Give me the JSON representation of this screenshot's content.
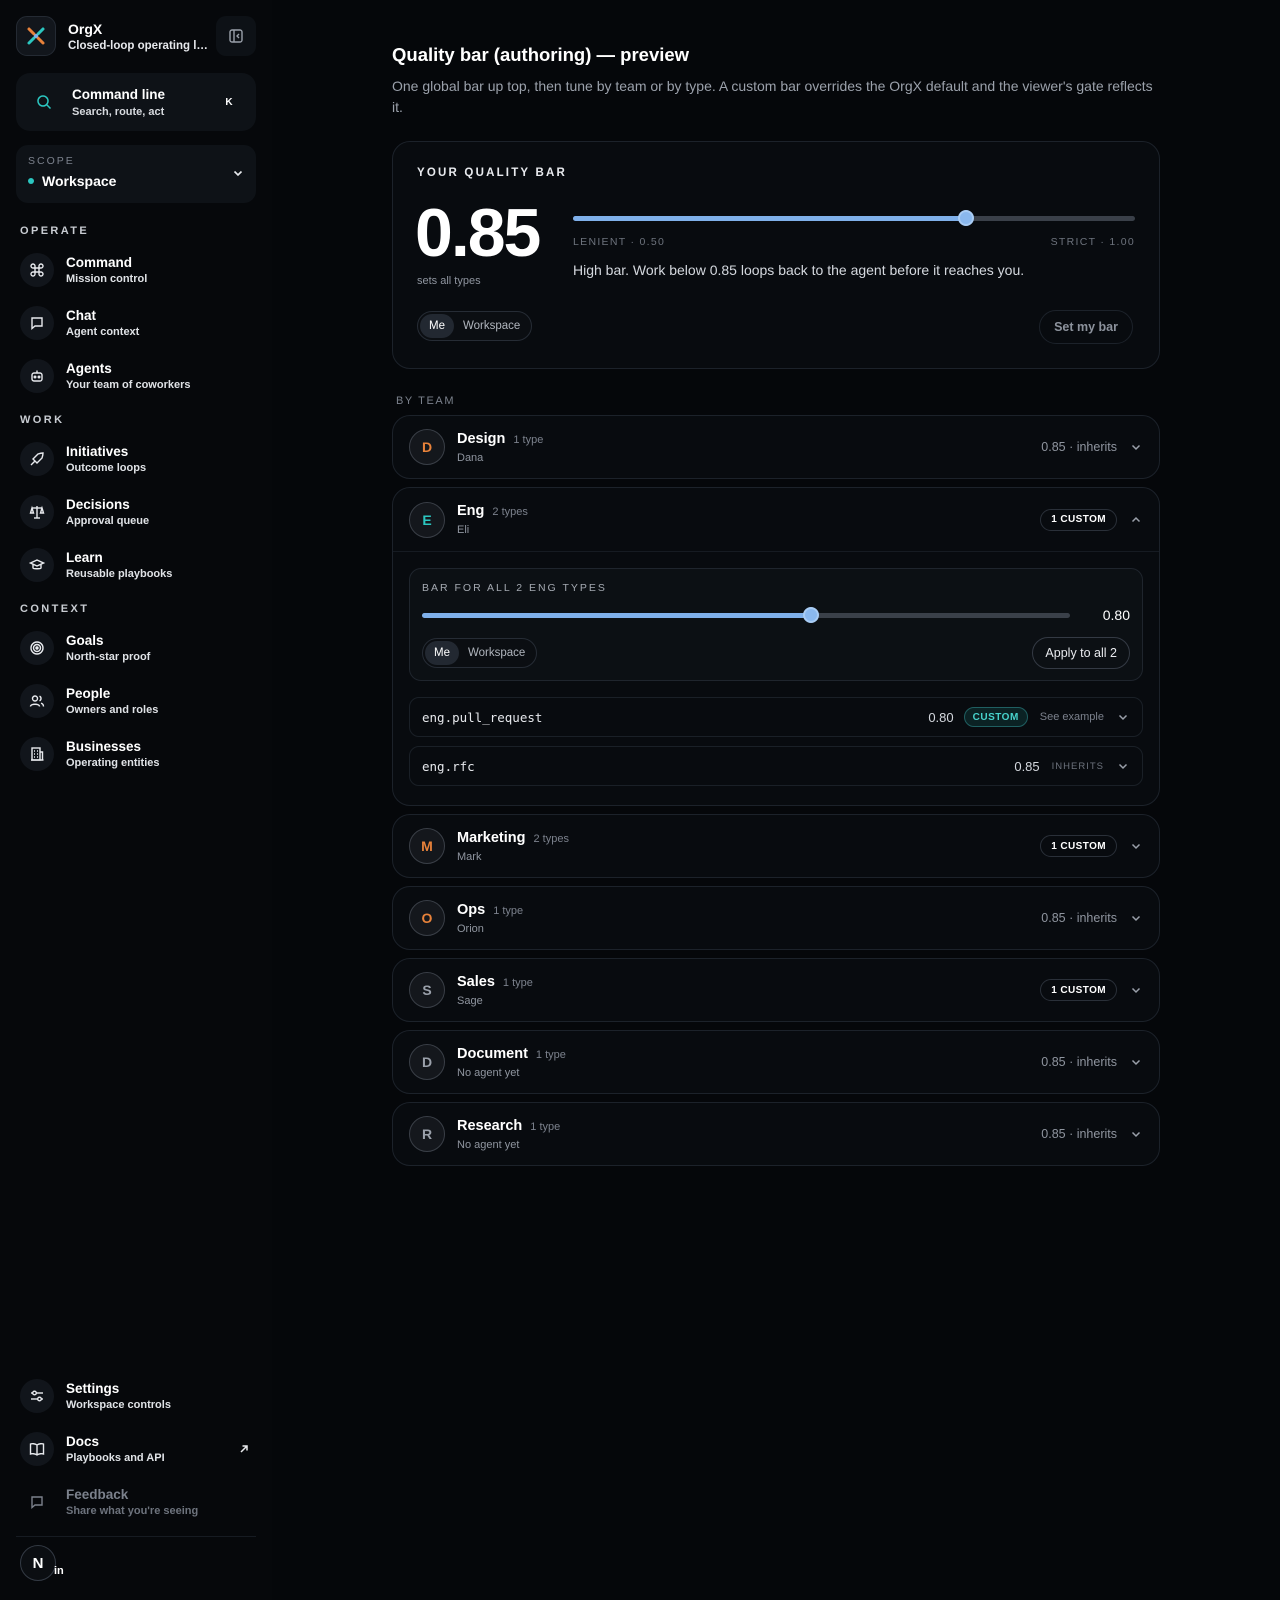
{
  "sidebar": {
    "brand": {
      "title": "OrgX",
      "subtitle": "Closed-loop operating layer"
    },
    "command_line": {
      "title": "Command line",
      "subtitle": "Search, route, act",
      "shortcut": "K"
    },
    "scope": {
      "label": "SCOPE",
      "value": "Workspace"
    },
    "sections": [
      {
        "label": "OPERATE",
        "items": [
          {
            "title": "Command",
            "subtitle": "Mission control",
            "icon": "command-icon"
          },
          {
            "title": "Chat",
            "subtitle": "Agent context",
            "icon": "chat-icon"
          },
          {
            "title": "Agents",
            "subtitle": "Your team of coworkers",
            "icon": "bot-icon"
          }
        ]
      },
      {
        "label": "WORK",
        "items": [
          {
            "title": "Initiatives",
            "subtitle": "Outcome loops",
            "icon": "rocket-icon"
          },
          {
            "title": "Decisions",
            "subtitle": "Approval queue",
            "icon": "scale-icon"
          },
          {
            "title": "Learn",
            "subtitle": "Reusable playbooks",
            "icon": "graduation-cap-icon"
          }
        ]
      },
      {
        "label": "CONTEXT",
        "items": [
          {
            "title": "Goals",
            "subtitle": "North-star proof",
            "icon": "target-icon"
          },
          {
            "title": "People",
            "subtitle": "Owners and roles",
            "icon": "people-icon"
          },
          {
            "title": "Businesses",
            "subtitle": "Operating entities",
            "icon": "building-icon"
          }
        ]
      }
    ],
    "bottom": [
      {
        "title": "Settings",
        "subtitle": "Workspace controls",
        "icon": "sliders-icon"
      },
      {
        "title": "Docs",
        "subtitle": "Playbooks and API",
        "icon": "book-icon"
      },
      {
        "title": "Feedback",
        "subtitle": "Share what you're seeing",
        "icon": "feedback-icon"
      }
    ],
    "user": {
      "avatar": "N",
      "tail": "in"
    }
  },
  "main": {
    "title": "Quality bar (authoring) — preview",
    "description": "One global bar up top, then tune by team or by type. A custom bar overrides the OrgX default and the viewer's gate reflects it.",
    "quality": {
      "label": "YOUR QUALITY BAR",
      "value": "0.85",
      "value_num": 0.85,
      "range": [
        0.5,
        1.0
      ],
      "sub": "sets all types",
      "lenient_label": "LENIENT · 0.50",
      "strict_label": "STRICT · 1.00",
      "note": "High bar. Work below 0.85 loops back to the agent before it reaches you.",
      "seg": [
        "Me",
        "Workspace"
      ],
      "set_button": "Set my bar"
    },
    "by_team_label": "BY TEAM",
    "teams": [
      {
        "letter": "D",
        "name": "Design",
        "count": "1 type",
        "owner": "Dana",
        "status": "0.85 · inherits",
        "color": "#e8823a"
      },
      {
        "letter": "E",
        "name": "Eng",
        "count": "2 types",
        "owner": "Eli",
        "status": "1 CUSTOM",
        "color": "#2bc6c0"
      },
      {
        "letter": "M",
        "name": "Marketing",
        "count": "2 types",
        "owner": "Mark",
        "status": "1 CUSTOM",
        "color": "#e8823a"
      },
      {
        "letter": "O",
        "name": "Ops",
        "count": "1 type",
        "owner": "Orion",
        "status": "0.85 · inherits",
        "color": "#e8823a"
      },
      {
        "letter": "S",
        "name": "Sales",
        "count": "1 type",
        "owner": "Sage",
        "status": "1 CUSTOM",
        "color": "#9aa0aa"
      },
      {
        "letter": "D",
        "name": "Document",
        "count": "1 type",
        "owner": "No agent yet",
        "status": "0.85 · inherits",
        "color": "#9aa0aa"
      },
      {
        "letter": "R",
        "name": "Research",
        "count": "1 type",
        "owner": "No agent yet",
        "status": "0.85 · inherits",
        "color": "#9aa0aa"
      }
    ],
    "eng_expanded": {
      "bar_label": "BAR FOR ALL 2 ENG TYPES",
      "value": "0.80",
      "value_num": 0.8,
      "seg": [
        "Me",
        "Workspace"
      ],
      "apply_button": "Apply to all 2",
      "types": [
        {
          "name": "eng.pull_request",
          "value": "0.80",
          "tag": "CUSTOM",
          "extra": "See example"
        },
        {
          "name": "eng.rfc",
          "value": "0.85",
          "tag": "INHERITS"
        }
      ]
    }
  }
}
